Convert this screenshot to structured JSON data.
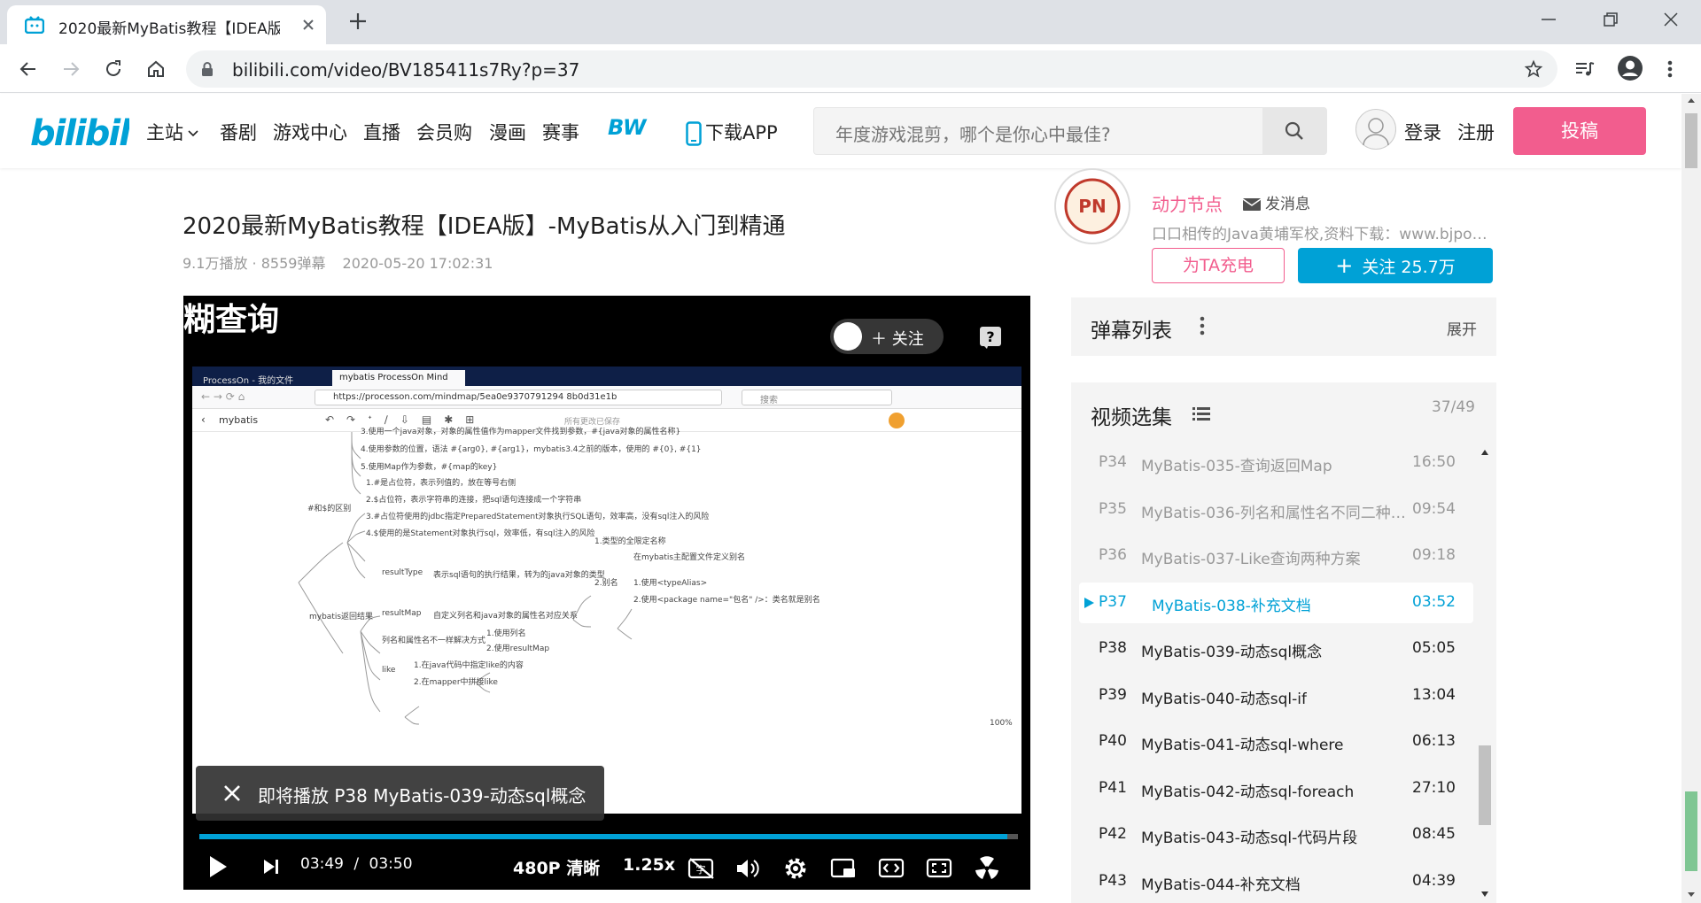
{
  "browser": {
    "tab_title": "2020最新MyBatis教程【IDEA版",
    "url": "bilibili.com/video/BV185411s7Ry?p=37"
  },
  "header": {
    "logo": "bilibili",
    "nav": [
      "主站",
      "番剧",
      "游戏中心",
      "直播",
      "会员购",
      "漫画",
      "赛事"
    ],
    "bw_badge": "BW",
    "download_app": "下载APP",
    "search_placeholder": "年度游戏混剪，哪个是你心中最佳?",
    "login": "登录",
    "register": "注册",
    "upload": "投稿"
  },
  "video": {
    "title": "2020最新MyBatis教程【IDEA版】-MyBatis从入门到精通",
    "views": "9.1万播放",
    "danmaku_count": "8559弹幕",
    "date": "2020-05-20 17:02:31"
  },
  "player": {
    "frame_title": "糊查询",
    "follow_label": "关注",
    "next_up": "即将播放 P38 MyBatis-039-动态sql概念",
    "progress": 0.987,
    "time_current": "03:49",
    "time_separator": "/",
    "time_total": "03:50",
    "quality": "480P 清晰",
    "speed": "1.25x",
    "inner": {
      "tabs": [
        "ProcessOn - 我的文件",
        "mybatis ProcessOn Mind"
      ],
      "url": "https://processon.com/mindmap/5ea0e9370791294 8b0d31e1b",
      "search_ph": "搜索",
      "project": "mybatis",
      "saved": "所有更改已保存",
      "zoom": "100%",
      "mindmap": [
        "3.使用一个java对象，对象的属性值作为mapper文件找到参数，#{java对象的属性名称}",
        "4.使用参数的位置，语法 #{arg0}, #{arg1}，mybatis3.4之前的版本，使用的 #{0}, #{1}",
        "5.使用Map作为参数，#{map的key}",
        "1.#是占位符，表示列值的，放在等号右侧",
        "2.$占位符，表示字符串的连接，把sql语句连接成一个字符串",
        "3.#占位符使用的jdbc指定PreparedStatement对象执行SQL语句，效率高，没有sql注入的风险",
        "4.$使用的是Statement对象执行sql，效率低，有sql注入的风险",
        "#和$的区别",
        "1.类型的全限定名称",
        "在mybatis主配置文件定义别名",
        "resultType",
        "表示sql语句的执行结果，转为的java对象的类型",
        "2.别名",
        "1.使用<typeAlias>",
        "2.使用<package name=\"包名\" />：类名就是别名",
        "mybatis返回结果",
        "resultMap",
        "自定义列名和java对象的属性名对应关系",
        "列名和属性名不一样解决方式",
        "1.使用列名",
        "2.使用resultMap",
        "like",
        "1.在java代码中指定like的内容",
        "2.在mapper中拼接like"
      ]
    }
  },
  "uploader": {
    "name": "动力节点",
    "message": "发消息",
    "description": "口口相传的Java黄埔军校,资料下载：www.bjpowernode.com",
    "charge": "为TA充电",
    "follow": "关注 25.7万"
  },
  "danmaku_list": {
    "title": "弹幕列表",
    "expand": "展开"
  },
  "episodes": {
    "title": "视频选集",
    "count": "37/49",
    "items": [
      {
        "p": "P34",
        "name": "MyBatis-035-查询返回Map",
        "dur": "16:50",
        "state": "watched"
      },
      {
        "p": "P35",
        "name": "MyBatis-036-列名和属性名不同二种方案",
        "dur": "09:54",
        "state": "watched"
      },
      {
        "p": "P36",
        "name": "MyBatis-037-Like查询两种方案",
        "dur": "09:18",
        "state": "watched"
      },
      {
        "p": "P37",
        "name": "MyBatis-038-补充文档",
        "dur": "03:52",
        "state": "active"
      },
      {
        "p": "P38",
        "name": "MyBatis-039-动态sql概念",
        "dur": "05:05",
        "state": "unwatched"
      },
      {
        "p": "P39",
        "name": "MyBatis-040-动态sql-if",
        "dur": "13:04",
        "state": "unwatched"
      },
      {
        "p": "P40",
        "name": "MyBatis-041-动态sql-where",
        "dur": "06:13",
        "state": "unwatched"
      },
      {
        "p": "P41",
        "name": "MyBatis-042-动态sql-foreach",
        "dur": "27:10",
        "state": "unwatched"
      },
      {
        "p": "P42",
        "name": "MyBatis-043-动态sql-代码片段",
        "dur": "08:45",
        "state": "unwatched"
      },
      {
        "p": "P43",
        "name": "MyBatis-044-补充文档",
        "dur": "04:39",
        "state": "unwatched"
      }
    ]
  },
  "colors": {
    "brand_blue": "#00a1d6",
    "brand_pink": "#f25d8e"
  }
}
